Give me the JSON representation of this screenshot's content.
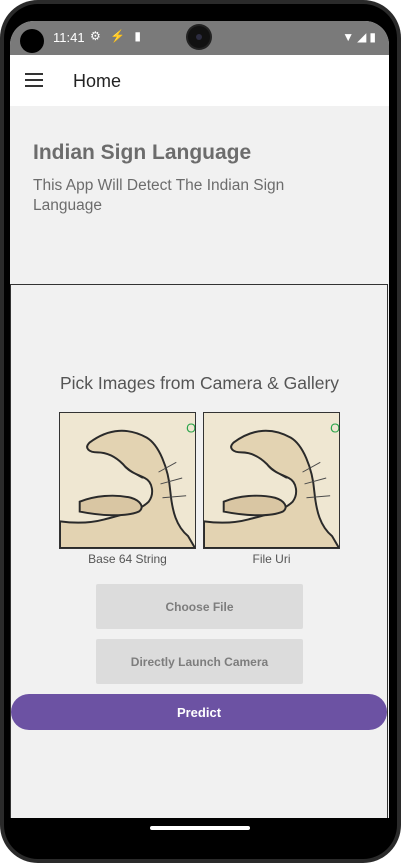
{
  "status_bar": {
    "time": "11:41",
    "left_icons": "⚙ ⚡ ▮",
    "right_icons": "▼◢▮"
  },
  "app_bar": {
    "title": "Home"
  },
  "header": {
    "title": "Indian Sign Language",
    "subtitle": "This App Will Detect The Indian Sign Language"
  },
  "picker": {
    "title": "Pick Images from Camera & Gallery",
    "left_label": "Base 64 String",
    "right_label": "File Uri"
  },
  "buttons": {
    "choose_file": "Choose File",
    "launch_camera": "Directly Launch Camera",
    "predict": "Predict"
  },
  "colors": {
    "accent": "#6c52a3",
    "status_bar": "#7a7a7a",
    "button_bg": "#dcdcdc"
  }
}
